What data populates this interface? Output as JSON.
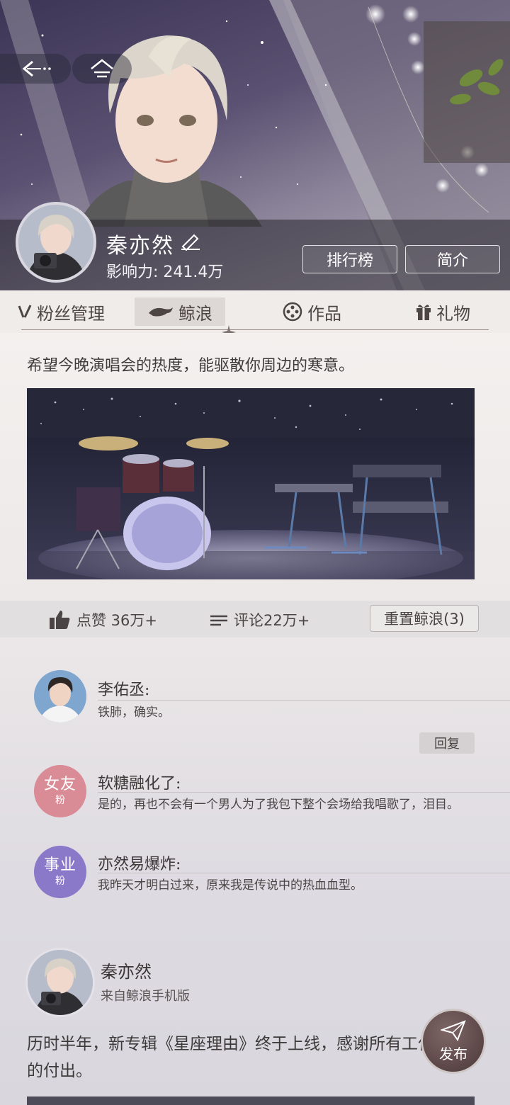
{
  "header": {
    "name": "秦亦然",
    "influence_label": "影响力:",
    "influence_value": "241.4万",
    "ranking_button": "排行榜",
    "intro_button": "简介"
  },
  "tabs": [
    {
      "label": "粉丝管理",
      "icon": "fan-icon"
    },
    {
      "label": "鲸浪",
      "icon": "whale-icon"
    },
    {
      "label": "作品",
      "icon": "film-reel-icon"
    },
    {
      "label": "礼物",
      "icon": "gift-icon"
    }
  ],
  "post": {
    "text": "希望今晚演唱会的热度，能驱散你周边的寒意。",
    "image_desc_icon": "stage-drums-keyboard-image",
    "like_label": "点赞 36万+",
    "comment_label": "评论22万+",
    "reset_label": "重置鲸浪(3)"
  },
  "comments": [
    {
      "name": "李佑丞:",
      "text": "铁肺，确实。",
      "avatar": "portrait-avatar"
    },
    {
      "name": "软糖融化了:",
      "text": "是的，再也不会有一个男人为了我包下整个会场给我唱歌了，泪目。",
      "badge_main": "女友",
      "badge_sub": "粉"
    },
    {
      "name": "亦然易爆炸:",
      "text": "我昨天才明白过来，原来我是传说中的热血血型。",
      "badge_main": "事业",
      "badge_sub": "粉"
    }
  ],
  "reply_label": "回复",
  "post2": {
    "name": "秦亦然",
    "source": "来自鲸浪手机版",
    "text": "历时半年，新专辑《星座理由》终于上线，感谢所有工作人员的付出。"
  },
  "publish_label": "发布",
  "colors": {
    "hero_dark": "#3c3555",
    "badge_girlfriend": "#d98b96",
    "badge_career": "#8a79c9",
    "publish_bg": "#5b4647"
  }
}
